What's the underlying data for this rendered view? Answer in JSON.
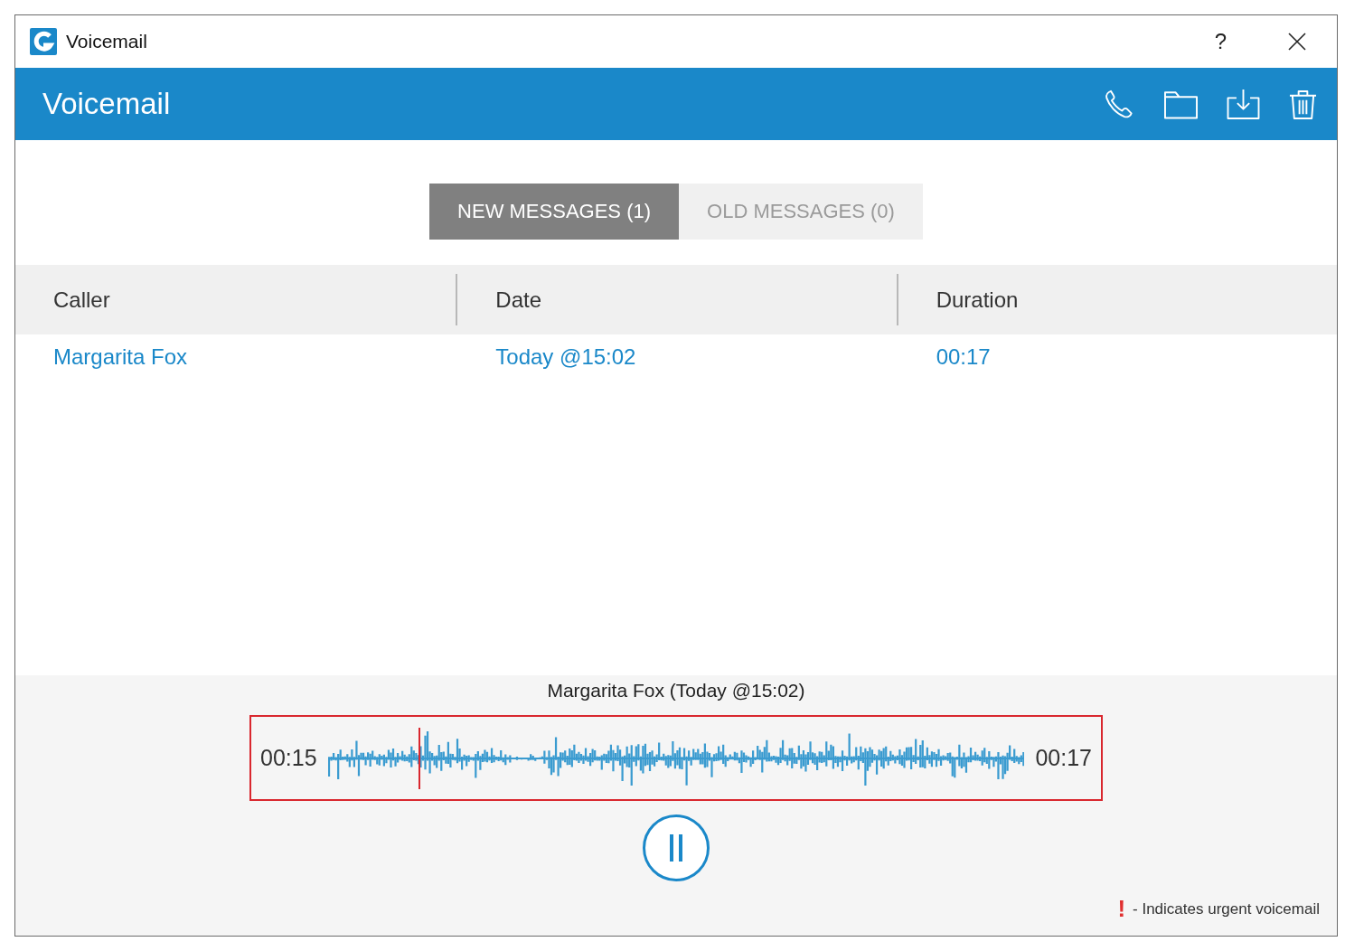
{
  "window": {
    "title": "Voicemail",
    "help": "?"
  },
  "header": {
    "title": "Voicemail"
  },
  "tabs": [
    {
      "label": "NEW MESSAGES (1)",
      "selected": true
    },
    {
      "label": "OLD MESSAGES (0)",
      "selected": false
    }
  ],
  "table": {
    "columns": [
      "Caller",
      "Date",
      "Duration"
    ],
    "rows": [
      {
        "caller": "Margarita Fox",
        "date": "Today @15:02",
        "duration": "00:17"
      }
    ]
  },
  "player": {
    "title": "Margarita Fox (Today @15:02)",
    "elapsed": "00:15",
    "total": "00:17",
    "level": 0.13,
    "playing": true
  },
  "legend": {
    "mark": "!",
    "text": "- Indicates urgent voicemail"
  }
}
